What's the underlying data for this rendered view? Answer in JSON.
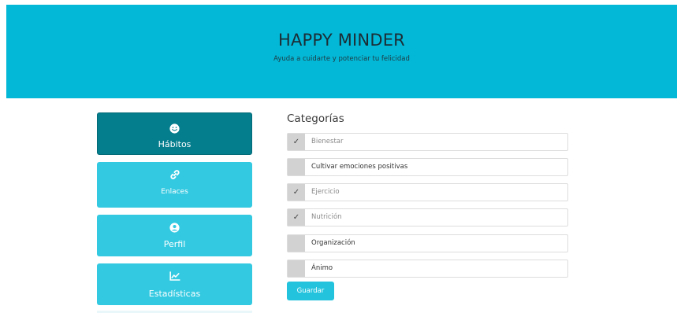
{
  "header": {
    "title": "HAPPY MINDER",
    "subtitle": "Ayuda a cuidarte y potenciar tu felicidad"
  },
  "nav": [
    {
      "label": "Hábitos",
      "icon": "smile-icon",
      "active": true
    },
    {
      "label": "Enlaces",
      "icon": "link-icon",
      "active": false
    },
    {
      "label": "Perfil",
      "icon": "user-circle-icon",
      "active": false
    },
    {
      "label": "Estadísticas",
      "icon": "chart-line-icon",
      "active": false
    }
  ],
  "categories": {
    "title": "Categorías",
    "items": [
      {
        "label": "Bienestar",
        "checked": true,
        "check_glyph": "✓"
      },
      {
        "label": "Cultivar emociones positivas",
        "checked": false,
        "check_glyph": ""
      },
      {
        "label": "Ejercicio",
        "checked": true,
        "check_glyph": "✓"
      },
      {
        "label": "Nutrición",
        "checked": true,
        "check_glyph": "✓"
      },
      {
        "label": "Organización",
        "checked": false,
        "check_glyph": ""
      },
      {
        "label": "Ánimo",
        "checked": false,
        "check_glyph": ""
      }
    ],
    "save_label": "Guardar"
  },
  "colors": {
    "header_bg": "#03b8d6",
    "nav_bg": "#33c9e1",
    "nav_active_bg": "#047d8d",
    "button_bg": "#23c3dd"
  }
}
